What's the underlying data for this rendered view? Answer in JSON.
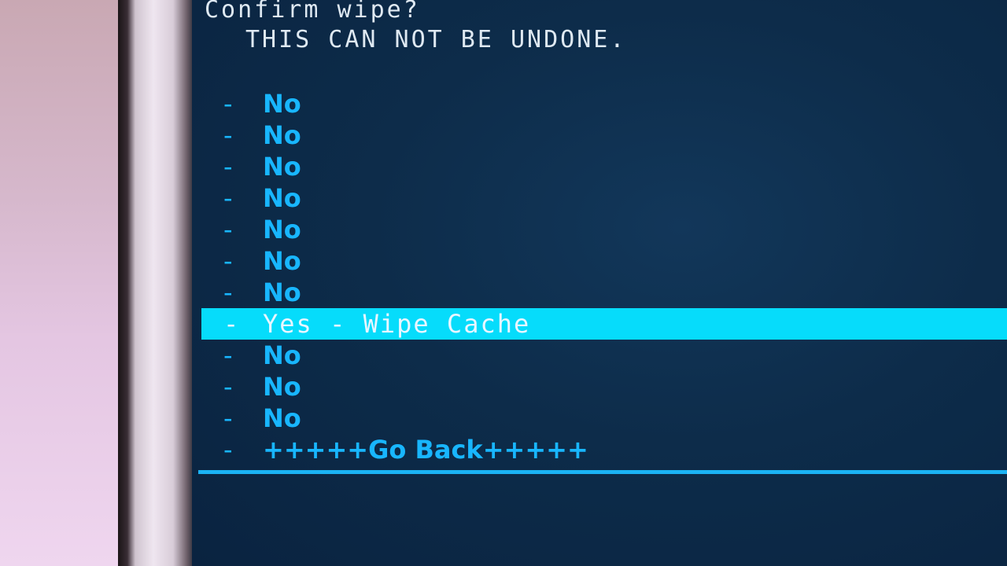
{
  "header": {
    "title": "Confirm wipe?",
    "warning": "THIS CAN NOT BE UNDONE."
  },
  "menu": {
    "items": [
      {
        "prefix": "-",
        "label": "No"
      },
      {
        "prefix": "-",
        "label": "No"
      },
      {
        "prefix": "-",
        "label": "No"
      },
      {
        "prefix": "-",
        "label": "No"
      },
      {
        "prefix": "-",
        "label": "No"
      },
      {
        "prefix": "-",
        "label": "No"
      },
      {
        "prefix": "-",
        "label": "No"
      },
      {
        "prefix": "-",
        "label": "Yes - Wipe Cache"
      },
      {
        "prefix": "-",
        "label": "No"
      },
      {
        "prefix": "-",
        "label": "No"
      },
      {
        "prefix": "-",
        "label": "No"
      },
      {
        "prefix": "-",
        "label": "+++++Go Back+++++"
      }
    ],
    "selected_index": 7
  },
  "colors": {
    "background": "#0d2c4a",
    "item_text": "#18b6ff",
    "highlight": "#06dcfb",
    "header_text": "#dfe9f2",
    "divider": "#1bb3f4"
  }
}
